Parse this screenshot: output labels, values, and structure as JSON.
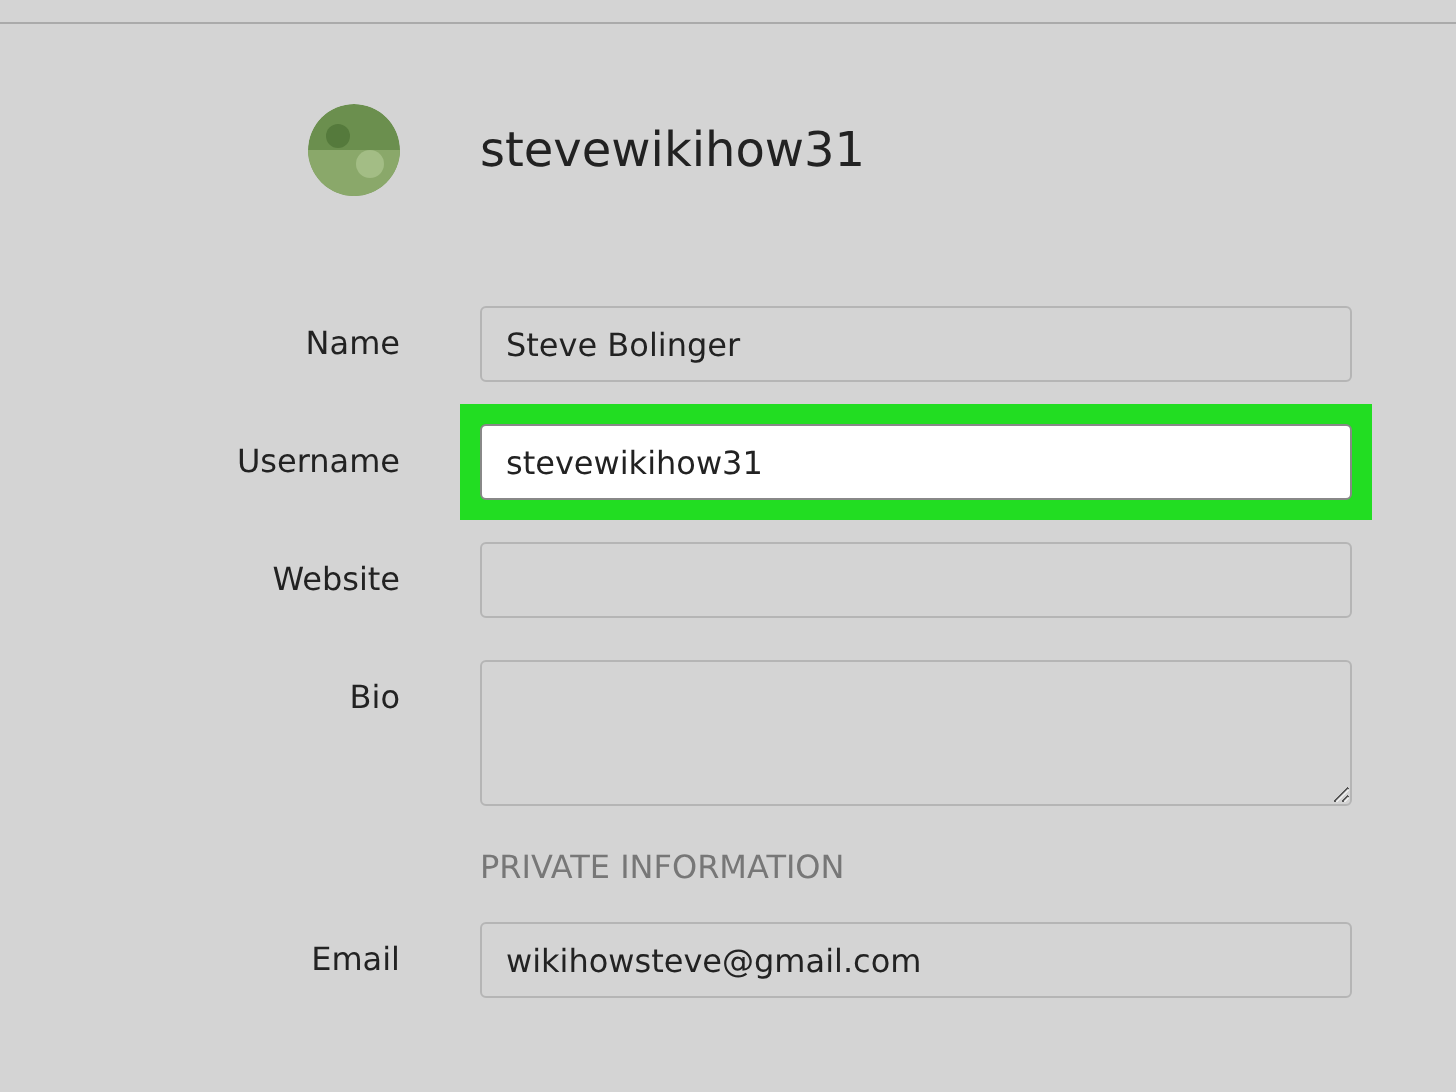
{
  "profile": {
    "username": "stevewikihow31"
  },
  "fields": [
    {
      "label": "Name",
      "kind": "text",
      "value": "Steve Bolinger",
      "highlighted": false
    },
    {
      "label": "Username",
      "kind": "text",
      "value": "stevewikihow31",
      "highlighted": true
    },
    {
      "label": "Website",
      "kind": "text",
      "highlighted": false
    },
    {
      "label": "Bio",
      "kind": "textarea",
      "highlighted": false
    }
  ],
  "section_heading": "PRIVATE INFORMATION",
  "private_fields": [
    {
      "label": "Email",
      "kind": "text",
      "value": "wikihowsteve@gmail.com",
      "highlighted": false
    }
  ]
}
